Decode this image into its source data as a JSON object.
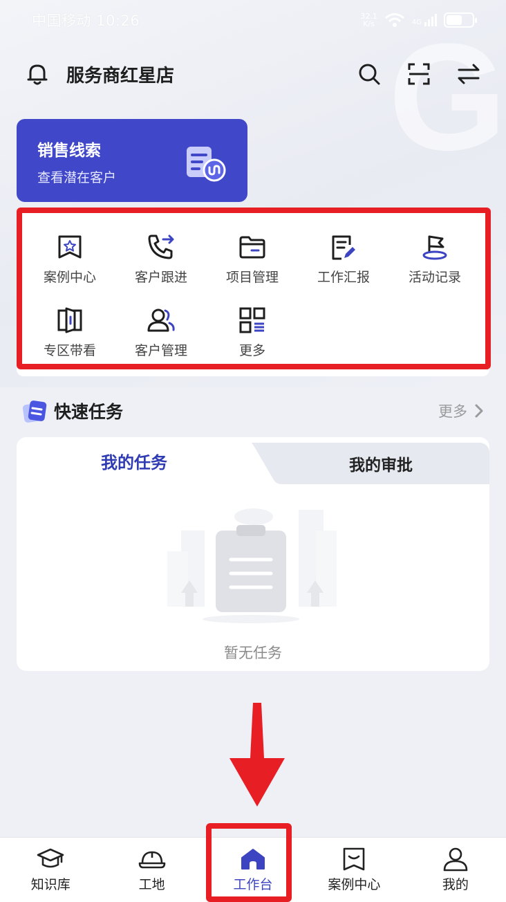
{
  "status_bar": {
    "carrier_time": "中国移动 10:26",
    "net_speed_value": "32.1",
    "net_speed_unit": "K/s",
    "signal_label": "4G"
  },
  "header": {
    "title": "服务商红星店"
  },
  "lead_card": {
    "title": "销售线索",
    "subtitle": "查看潜在客户"
  },
  "functions": [
    {
      "label": "案例中心",
      "icon": "case-center-icon"
    },
    {
      "label": "客户跟进",
      "icon": "customer-followup-icon"
    },
    {
      "label": "项目管理",
      "icon": "project-manage-icon"
    },
    {
      "label": "工作汇报",
      "icon": "work-report-icon"
    },
    {
      "label": "活动记录",
      "icon": "activity-record-icon"
    },
    {
      "label": "专区带看",
      "icon": "zone-visit-icon"
    },
    {
      "label": "客户管理",
      "icon": "customer-manage-icon"
    },
    {
      "label": "更多",
      "icon": "more-grid-icon"
    }
  ],
  "quick_tasks": {
    "title": "快速任务",
    "more": "更多",
    "tabs": [
      {
        "label": "我的任务",
        "active": true
      },
      {
        "label": "我的审批",
        "active": false
      }
    ],
    "empty_text": "暂无任务"
  },
  "bottom_nav": [
    {
      "label": "知识库",
      "icon": "graduation-cap-icon",
      "active": false
    },
    {
      "label": "工地",
      "icon": "hard-hat-icon",
      "active": false
    },
    {
      "label": "工作台",
      "icon": "home-icon",
      "active": true
    },
    {
      "label": "案例中心",
      "icon": "case-message-icon",
      "active": false
    },
    {
      "label": "我的",
      "icon": "user-icon",
      "active": false
    }
  ],
  "colors": {
    "accent": "#3c44c2",
    "lead_card_bg": "#4047c9",
    "annotation_red": "#e81e25"
  }
}
